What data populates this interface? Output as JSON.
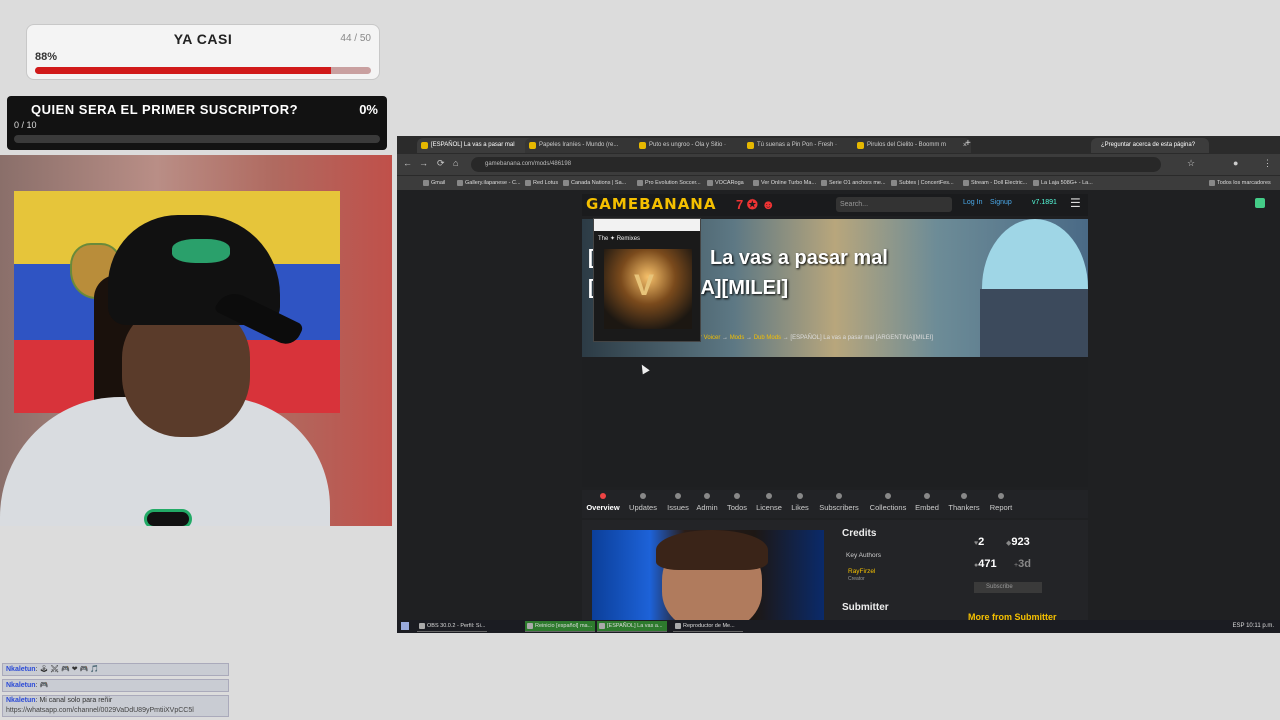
{
  "goal": {
    "title": "YA CASI",
    "count": "44 / 50",
    "percent_text": "88%",
    "fraction": 0.88
  },
  "subs_goal": {
    "question": "QUIEN SERA EL PRIMER SUSCRIPTOR?",
    "percent_text": "0%",
    "count": "0 / 10",
    "fraction": 0
  },
  "chat": [
    {
      "name": "Nkaletun",
      "text": "🕹 ⚔ 🎮 ❤ 🎮 🎵"
    },
    {
      "name": "Nkaletun",
      "text": "🎮"
    },
    {
      "name": "Nkaletun",
      "text": "Mi canal solo para reñir",
      "link": "https://whatsapp.com/channel/0029VaDdU89yPmtiiXVpCC5l"
    }
  ],
  "browser": {
    "tabs": [
      "[ESPAÑOL] La vas a pasar mal",
      "Papeles Iraníes - Mundo (re...",
      "Puto es ungroo - Ola y Sitio ·",
      "Tú suenas a Pin Pon - Fresh ·",
      "Pirulos del Cielito - Boomm m"
    ],
    "new_tab": "+",
    "side_tab": "¿Preguntar acerca de esta página?",
    "url": "gamebanana.com/mods/486198",
    "bookmarks": [
      "Gmail",
      "Gallery.ilapanese - C...",
      "Red Lotus",
      "Canada Nations | Sa...",
      "Pro Evolution Soccer...",
      "VOCARoga",
      "Ver Online Turbo Ma...",
      "Serie O1 anchors me...",
      "Subtes | ConcertFes...",
      "Stream - Doll Electric...",
      "La Laja 508G+ - La..."
    ],
    "bookmarks_right": "Todos los marcadores"
  },
  "gamebanana": {
    "logo": "GAMEBANANA",
    "search_placeholder": "Search...",
    "login": "Log In",
    "signup": "Signup",
    "version": "v7.1891",
    "title_line1": "La vas a pasar mal",
    "title_line2": "NA][MILEI]",
    "title_prefix1": "[",
    "title_prefix2": "[",
    "crumbs": [
      "r Voicer",
      "→",
      "Mods",
      "→",
      "Dub Mods",
      "→",
      "[ESPAÑOL] La vas a pasar mal [ARGENTINA][MILEI]"
    ],
    "popup_title": "The ✦ Remixes",
    "menu": [
      "Overview",
      "Updates",
      "Issues",
      "Admin",
      "Todos",
      "License",
      "Likes",
      "Subscribers",
      "Collections",
      "Embed",
      "Thankers",
      "Report"
    ],
    "credits_label": "Credits",
    "key_authors": "Key Authors",
    "author_name": "RayFirzel",
    "author_role": "Creator",
    "submitter_label": "Submitter",
    "likes": "2",
    "views": "923",
    "posts": "471",
    "age": "3d",
    "subscribe": "Subscribe",
    "more_from": "More from Submitter"
  },
  "taskbar": {
    "items": [
      "OBS 30.0.2 - Perfil: Si...",
      "Reinicio [español] ma...",
      "[ESPAÑOL] La vas a...",
      "Reproductor de Me..."
    ],
    "tray": "ESP  10:11 p.m."
  }
}
